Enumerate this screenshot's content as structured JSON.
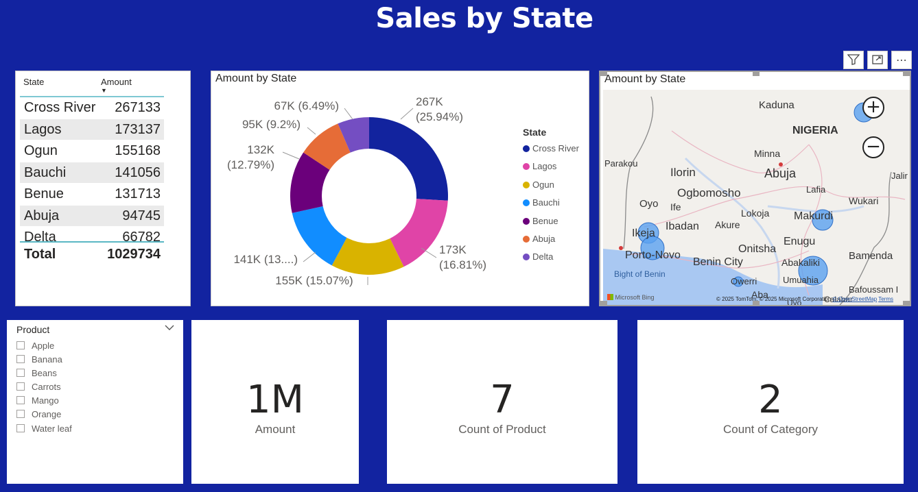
{
  "page": {
    "title": "Sales by State"
  },
  "table": {
    "headers": {
      "state": "State",
      "amount": "Amount"
    },
    "rows": [
      {
        "state": "Cross River",
        "amount": "267133"
      },
      {
        "state": "Lagos",
        "amount": "173137"
      },
      {
        "state": "Ogun",
        "amount": "155168"
      },
      {
        "state": "Bauchi",
        "amount": "141056"
      },
      {
        "state": "Benue",
        "amount": "131713"
      },
      {
        "state": "Abuja",
        "amount": "94745"
      },
      {
        "state": "Delta",
        "amount": "66782"
      }
    ],
    "total": {
      "label": "Total",
      "amount": "1029734"
    }
  },
  "chart_data": {
    "type": "pie",
    "title": "Amount by State",
    "legend_title": "State",
    "legend_position": "right",
    "categories": [
      "Cross River",
      "Lagos",
      "Ogun",
      "Bauchi",
      "Benue",
      "Abuja",
      "Delta"
    ],
    "values": [
      267133,
      173137,
      155168,
      141056,
      131713,
      94745,
      66782
    ],
    "colors": [
      "#12239e",
      "#e044a7",
      "#d9b300",
      "#118dff",
      "#6b007b",
      "#e66c37",
      "#744ec2"
    ],
    "data_labels": [
      [
        "267K",
        "(25.94%)"
      ],
      [
        "173K",
        "(16.81%)"
      ],
      [
        "155K (15.07%)"
      ],
      [
        "141K (13....)"
      ],
      [
        "132K",
        "(12.79%)"
      ],
      [
        "95K (9.2%)"
      ],
      [
        "67K (6.49%)"
      ]
    ]
  },
  "map": {
    "title": "Amount by State",
    "country_label": "NIGERIA",
    "water_label": "Bight of Benin",
    "cities": [
      "Kaduna",
      "Minna",
      "Abuja",
      "Parakou",
      "Ilorin",
      "Ogbomosho",
      "Oyo",
      "Ife",
      "Ibadan",
      "Akure",
      "Lokoja",
      "Lafia",
      "Makurdi",
      "Wukari",
      "Jalir",
      "Ikeja",
      "Porto-Novo",
      "Benin City",
      "Onitsha",
      "Enugu",
      "Abakaliki",
      "Bamenda",
      "Owerri",
      "Umuahia",
      "Bafoussam I",
      "Aba",
      "Uyo",
      "Calabar"
    ],
    "bing_label": "Microsoft Bing",
    "credit_text": "© 2025 TomTom, © 2025 Microsoft Corporation",
    "credit_osm": "© OpenStreetMap",
    "credit_terms": "Terms",
    "zoom_in": "+",
    "zoom_out": "−"
  },
  "slicer": {
    "title": "Product",
    "items": [
      "Apple",
      "Banana",
      "Beans",
      "Carrots",
      "Mango",
      "Orange",
      "Water leaf"
    ]
  },
  "kpis": [
    {
      "value": "1M",
      "label": "Amount"
    },
    {
      "value": "7",
      "label": "Count of Product"
    },
    {
      "value": "2",
      "label": "Count of Category"
    }
  ],
  "icons": [
    "filter-icon",
    "focus-mode-icon",
    "more-options-icon",
    "chevron-down-icon",
    "sort-descending-icon"
  ]
}
